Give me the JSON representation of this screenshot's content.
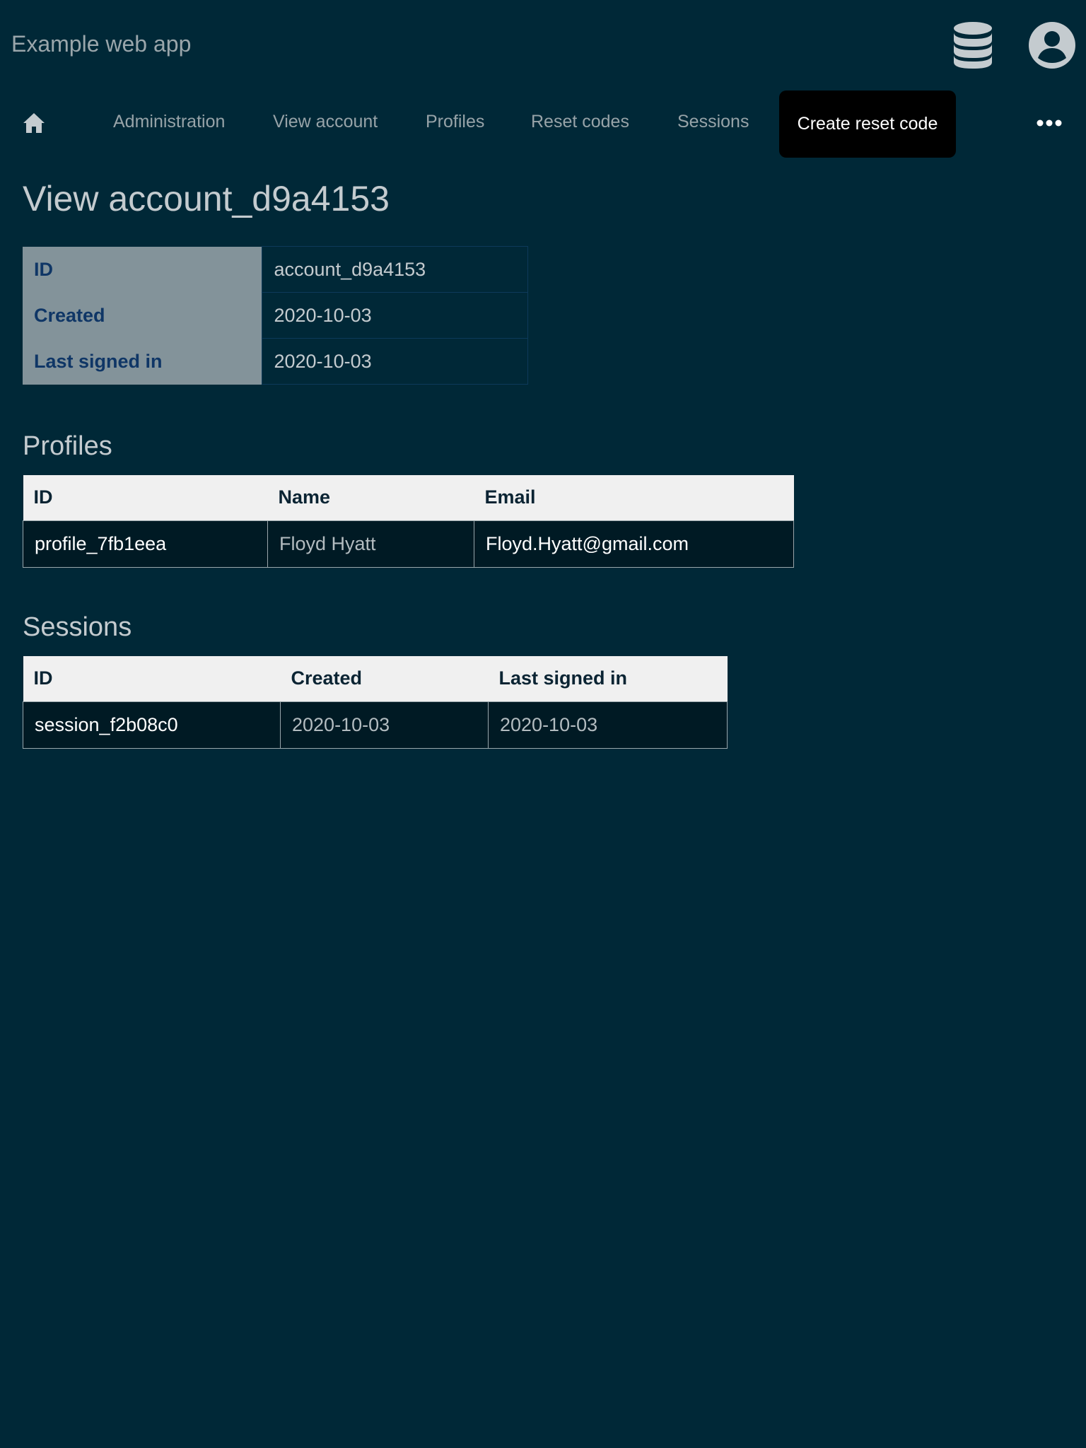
{
  "header": {
    "app_title": "Example web app",
    "icons": [
      "database-icon",
      "user-account-icon"
    ]
  },
  "nav": {
    "home_icon": "home-icon",
    "items": [
      {
        "label": "Administration"
      },
      {
        "label": "View account"
      },
      {
        "label": "Profiles"
      },
      {
        "label": "Reset codes"
      },
      {
        "label": "Sessions"
      }
    ],
    "cta_label": "Create reset code",
    "more_icon": "more-horizontal-icon"
  },
  "page": {
    "title": "View account_d9a4153"
  },
  "account_details": {
    "rows": [
      {
        "label": "ID",
        "value": "account_d9a4153"
      },
      {
        "label": "Created",
        "value": "2020-10-03"
      },
      {
        "label": "Last signed in",
        "value": "2020-10-03"
      }
    ]
  },
  "profiles": {
    "title": "Profiles",
    "columns": [
      "ID",
      "Name",
      "Email"
    ],
    "rows": [
      {
        "id": "profile_7fb1eea",
        "name": "Floyd Hyatt",
        "email": "Floyd.Hyatt@gmail.com"
      }
    ]
  },
  "sessions": {
    "title": "Sessions",
    "columns": [
      "ID",
      "Created",
      "Last signed in"
    ],
    "rows": [
      {
        "id": "session_f2b08c0",
        "created": "2020-10-03",
        "last_signed_in": "2020-10-03"
      }
    ]
  },
  "colors": {
    "background": "#002837",
    "detail_label_bg": "#83939a",
    "detail_label_text": "#0f3666",
    "table_header_bg": "#f0f0f0",
    "cta_bg": "#000000"
  }
}
